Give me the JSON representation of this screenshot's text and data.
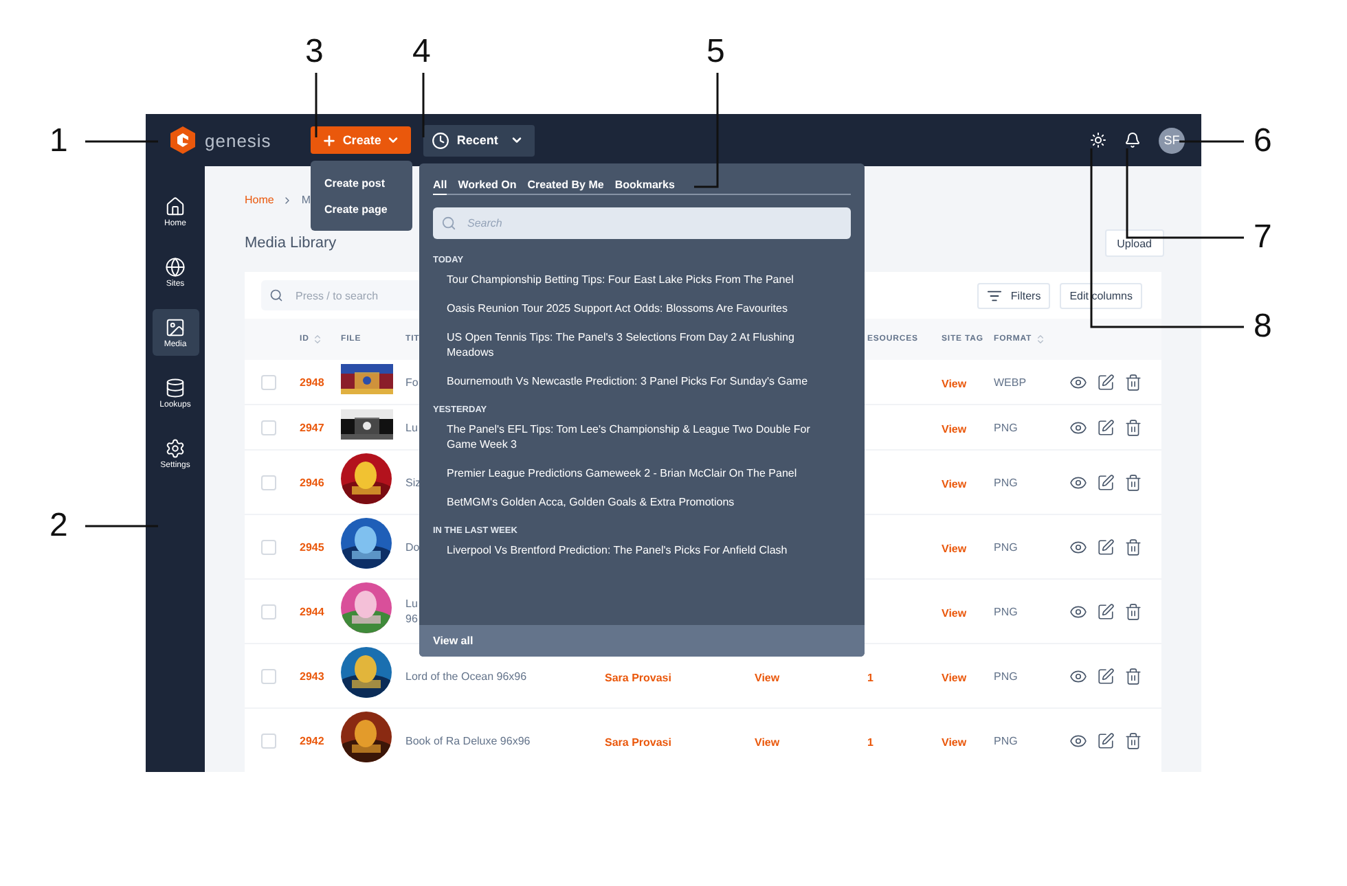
{
  "callouts": [
    {
      "number": "1"
    },
    {
      "number": "2"
    },
    {
      "number": "3"
    },
    {
      "number": "4"
    },
    {
      "number": "5"
    },
    {
      "number": "6"
    },
    {
      "number": "7"
    },
    {
      "number": "8"
    }
  ],
  "topbar": {
    "brand": "genesis",
    "create_button": "Create",
    "recent_button": "Recent",
    "avatar": "SF"
  },
  "sidebar": {
    "items": [
      {
        "label": "Home",
        "selected": false
      },
      {
        "label": "Sites",
        "selected": false
      },
      {
        "label": "Media",
        "selected": true
      },
      {
        "label": "Lookups",
        "selected": false
      },
      {
        "label": "Settings",
        "selected": false
      }
    ]
  },
  "breadcrumb": [
    "Home",
    "M"
  ],
  "page_title": "Media Library",
  "upload_button": "Upload",
  "toolbar": {
    "search": {
      "placeholder": "Press / to search"
    },
    "filters_button": "Filters",
    "edit_columns_button": "Edit columns"
  },
  "table": {
    "columns": [
      {
        "label": "ID",
        "sortable": true
      },
      {
        "label": "FILE",
        "sortable": false
      },
      {
        "label": "TIT",
        "sortable": false
      },
      {
        "label": "ESOURCES",
        "sortable": false
      },
      {
        "label": "SITE TAG",
        "sortable": false
      },
      {
        "label": "FORMAT",
        "sortable": true
      }
    ],
    "rows": [
      {
        "checked": false,
        "id": "2948",
        "kind": "rectangle",
        "title": [
          "Fo"
        ],
        "site_tag": "View",
        "format": "WEBP"
      },
      {
        "checked": false,
        "id": "2947",
        "kind": "rectangle",
        "title": [
          "Lu"
        ],
        "site_tag": "View",
        "format": "PNG"
      },
      {
        "checked": false,
        "id": "2946",
        "kind": "circle",
        "title": [
          "Siz"
        ],
        "site_tag": "View",
        "format": "PNG"
      },
      {
        "checked": false,
        "id": "2945",
        "kind": "circle",
        "title": [
          "Do"
        ],
        "site_tag": "View",
        "format": "PNG"
      },
      {
        "checked": false,
        "id": "2944",
        "kind": "circle",
        "title": [
          "Lu",
          "96"
        ],
        "site_tag": "View",
        "format": "PNG"
      },
      {
        "checked": false,
        "id": "2943",
        "kind": "circle",
        "title": [
          "Lord of the Ocean 96x96"
        ],
        "author": "Sara Provasi",
        "link": "View",
        "resources": "1",
        "site_tag": "View",
        "format": "PNG"
      },
      {
        "checked": false,
        "id": "2942",
        "kind": "circle",
        "title": [
          "Book of Ra Deluxe 96x96"
        ],
        "author": "Sara Provasi",
        "link": "View",
        "resources": "1",
        "site_tag": "View",
        "format": "PNG"
      }
    ]
  },
  "create_menu": {
    "items": [
      "Create post",
      "Create page"
    ]
  },
  "recent_panel": {
    "tabs": [
      {
        "label": "All",
        "selected": true
      },
      {
        "label": "Worked On",
        "selected": false
      },
      {
        "label": "Created By Me",
        "selected": false
      },
      {
        "label": "Bookmarks",
        "selected": false
      }
    ],
    "search": {
      "placeholder": "Search"
    },
    "groups": [
      {
        "heading": "TODAY",
        "items": [
          "Tour Championship Betting Tips: Four East Lake Picks From The Panel",
          "Oasis Reunion Tour 2025 Support Act Odds: Blossoms Are Favourites",
          "US Open Tennis Tips: The Panel's 3 Selections From Day 2 At Flushing Meadows",
          "Bournemouth Vs Newcastle Prediction: 3 Panel Picks For Sunday's Game"
        ]
      },
      {
        "heading": "YESTERDAY",
        "items": [
          "The Panel's EFL Tips: Tom Lee's Championship & League Two Double For Game Week 3",
          "Premier League Predictions Gameweek 2 - Brian McClair On The Panel",
          "BetMGM's Golden Acca, Golden Goals & Extra Promotions"
        ]
      },
      {
        "heading": "IN THE LAST WEEK",
        "items": [
          "Liverpool Vs Brentford Prediction: The Panel's Picks For Anfield Clash"
        ]
      }
    ],
    "footer": "View all"
  }
}
